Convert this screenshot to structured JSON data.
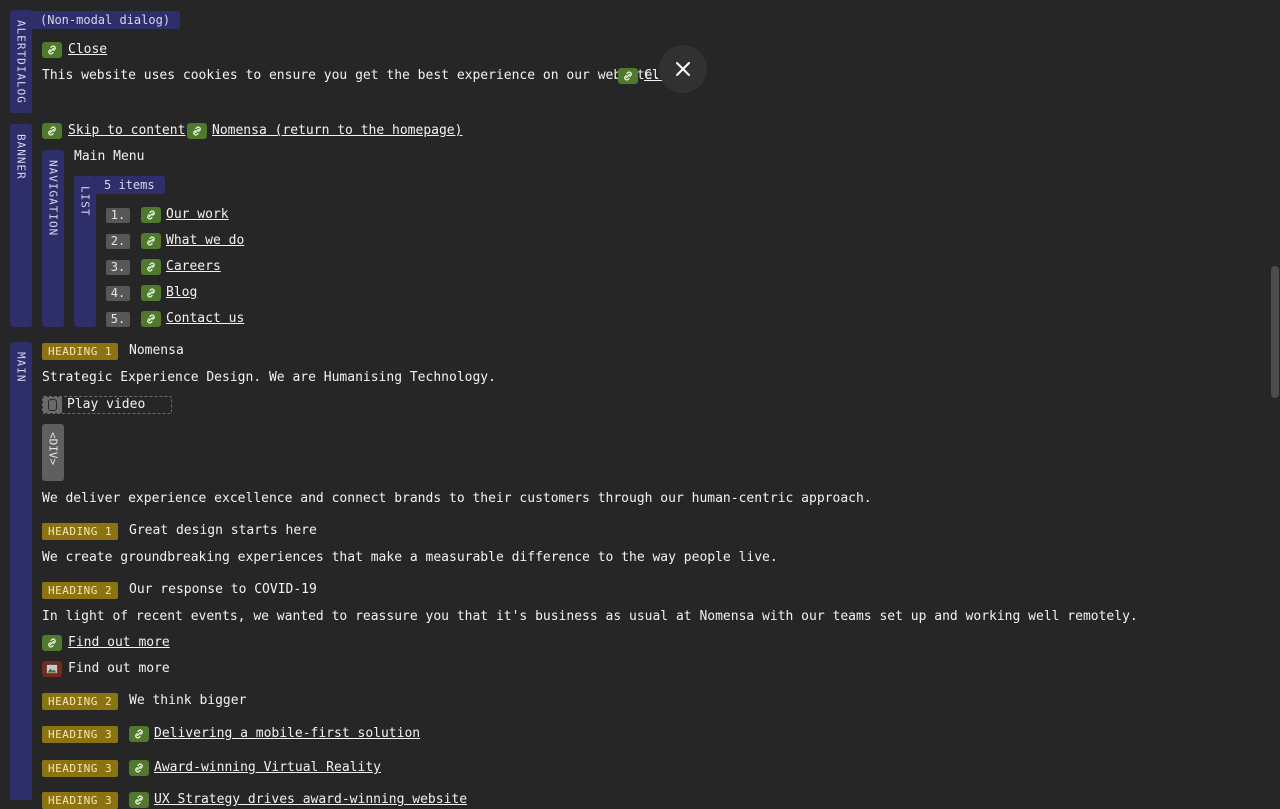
{
  "alertdialog": {
    "region_label": "ALERTDIALOG",
    "chip": "(Non-modal dialog)",
    "close_link": "Close",
    "message": "This website uses cookies to ensure you get the best experience on our website.",
    "close_link_inline": "Close"
  },
  "banner": {
    "region_label": "BANNER",
    "skip_link": "Skip to content",
    "home_link": "Nomensa (return to the homepage)",
    "navigation": {
      "region_label": "NAVIGATION",
      "title": "Main Menu",
      "list": {
        "region_label": "LIST",
        "count": "5 items",
        "items": [
          {
            "num": "1.",
            "label": "Our work"
          },
          {
            "num": "2.",
            "label": "What we do"
          },
          {
            "num": "3.",
            "label": "Careers"
          },
          {
            "num": "4.",
            "label": "Blog"
          },
          {
            "num": "5.",
            "label": "Contact us"
          }
        ]
      }
    }
  },
  "main": {
    "region_label": "MAIN",
    "h1_badge": "HEADING 1",
    "h1": "Nomensa",
    "tagline": "Strategic Experience Design. We are Humanising Technology.",
    "play_video": "Play video",
    "div_label": "<DIV>",
    "intro": "We deliver experience excellence and connect brands to their customers through our human-centric approach.",
    "h1b_badge": "HEADING 1",
    "h1b": "Great design starts here",
    "p2": "We create groundbreaking experiences that make a measurable difference to the way people live.",
    "h2a_badge": "HEADING 2",
    "h2a": "Our response to COVID-19",
    "p3": "In light of recent events, we wanted to reassure you that it's business as usual at Nomensa with our teams set up and working well remotely.",
    "find_out_link": "Find out more",
    "find_out_image": "Find out more",
    "h2b_badge": "HEADING 2",
    "h2b": "We think bigger",
    "h3a_badge": "HEADING 3",
    "h3a": "Delivering a mobile-first solution",
    "h3b_badge": "HEADING 3",
    "h3b": "Award-winning Virtual Reality",
    "h3c_badge": "HEADING 3",
    "h3c": "UX Strategy drives award-winning website"
  },
  "colors": {
    "background": "#262626",
    "region_bar": "#2e2f6a",
    "link_icon": "#4f7a2d",
    "heading_badge": "#8c7312",
    "image_icon": "#7a2a1a"
  }
}
